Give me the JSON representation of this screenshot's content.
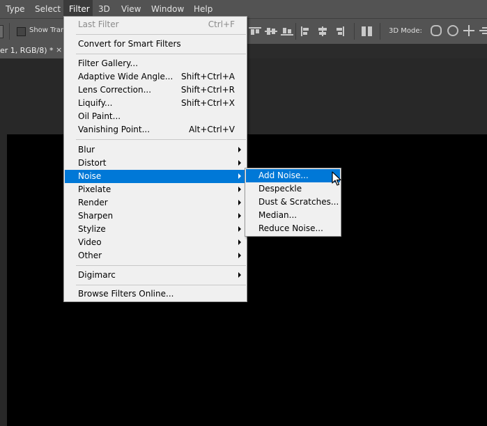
{
  "menubar": {
    "items": [
      {
        "label": "Type"
      },
      {
        "label": "Select"
      },
      {
        "label": "Filter",
        "active": true
      },
      {
        "label": "3D"
      },
      {
        "label": "View"
      },
      {
        "label": "Window"
      },
      {
        "label": "Help"
      }
    ]
  },
  "options_bar": {
    "show_transform_label": "Show Trans",
    "mode_label": "3D Mode:",
    "align_icons": [
      "align-top-edges-icon",
      "align-vertical-centers-icon",
      "align-bottom-edges-icon",
      "align-left-edges-icon",
      "align-horizontal-centers-icon",
      "align-right-edges-icon",
      "auto-align-layers-icon"
    ],
    "mode_icons": [
      "rotate-3d-icon",
      "roll-3d-icon",
      "drag-3d-icon",
      "slide-3d-icon"
    ]
  },
  "document_tab": {
    "title": "er 1, RGB/8) *",
    "close": "×"
  },
  "filter_menu": {
    "items": [
      {
        "label": "Last Filter",
        "shortcut": "Ctrl+F",
        "disabled": true
      },
      {
        "label": "Convert for Smart Filters"
      },
      {
        "label": "Filter Gallery..."
      },
      {
        "label": "Adaptive Wide Angle...",
        "shortcut": "Shift+Ctrl+A"
      },
      {
        "label": "Lens Correction...",
        "shortcut": "Shift+Ctrl+R"
      },
      {
        "label": "Liquify...",
        "shortcut": "Shift+Ctrl+X"
      },
      {
        "label": "Oil Paint..."
      },
      {
        "label": "Vanishing Point...",
        "shortcut": "Alt+Ctrl+V"
      },
      {
        "label": "Blur",
        "submenu": true
      },
      {
        "label": "Distort",
        "submenu": true
      },
      {
        "label": "Noise",
        "submenu": true,
        "highlighted": true
      },
      {
        "label": "Pixelate",
        "submenu": true
      },
      {
        "label": "Render",
        "submenu": true
      },
      {
        "label": "Sharpen",
        "submenu": true
      },
      {
        "label": "Stylize",
        "submenu": true
      },
      {
        "label": "Video",
        "submenu": true
      },
      {
        "label": "Other",
        "submenu": true
      },
      {
        "label": "Digimarc",
        "submenu": true
      },
      {
        "label": "Browse Filters Online..."
      }
    ]
  },
  "noise_submenu": {
    "items": [
      {
        "label": "Add Noise...",
        "highlighted": true
      },
      {
        "label": "Despeckle"
      },
      {
        "label": "Dust & Scratches..."
      },
      {
        "label": "Median..."
      },
      {
        "label": "Reduce Noise..."
      }
    ]
  },
  "colors": {
    "menu_highlight": "#0078d7",
    "menubar_bg": "#535353",
    "canvas": "#000000"
  }
}
